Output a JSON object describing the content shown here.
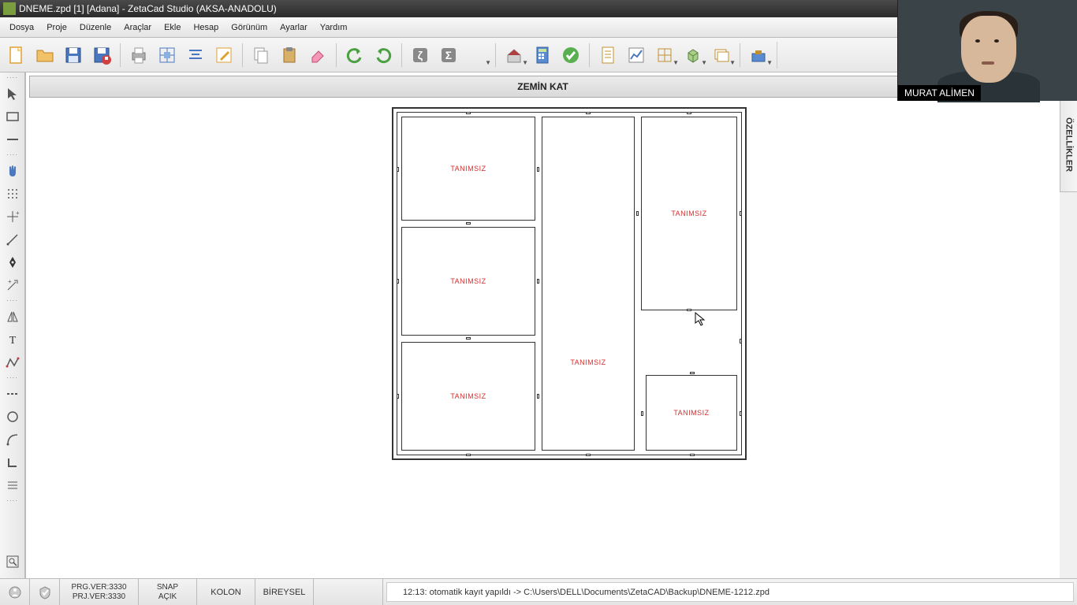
{
  "title": "DNEME.zpd  [1]  [Adana]   - ZetaCad Studio (AKSA-ANADOLU)",
  "menu": [
    "Dosya",
    "Proje",
    "Düzenle",
    "Araçlar",
    "Ekle",
    "Hesap",
    "Görünüm",
    "Ayarlar",
    "Yardım"
  ],
  "canvas_title": "ZEMİN KAT",
  "room_label": "TANIMSIZ",
  "right_panel": "ÖZELLİKLER",
  "webcam_name": "MURAT ALİMEN",
  "status": {
    "prg": "PRG.VER:3330",
    "prj": "PRJ.VER:3330",
    "snap1": "SNAP",
    "snap2": "AÇIK",
    "kolon": "KOLON",
    "bireysel": "BİREYSEL",
    "message": "12:13: otomatik kayıt yapıldı -> C:\\Users\\DELL\\Documents\\ZetaCAD\\Backup\\DNEME-1212.zpd"
  },
  "toolbar_icons": [
    "new-file",
    "open-file",
    "save-file",
    "save-as",
    "sep",
    "print",
    "grid-align",
    "align-center",
    "edit-note",
    "sep",
    "copy",
    "paste",
    "erase",
    "sep",
    "undo",
    "redo",
    "sep",
    "zeta-z",
    "zeta-sigma",
    "dropdown-empty",
    "sep",
    "home-dd",
    "calculator",
    "check-ok",
    "sep",
    "report",
    "chart",
    "structure-dd",
    "cube-dd",
    "window-dd",
    "sep",
    "toolbox-dd"
  ],
  "left_icons": [
    "dots-row",
    "pointer",
    "rect",
    "line",
    "dots-row",
    "hand",
    "grid-dots",
    "crosshair-plus",
    "diagonal",
    "pen-nib",
    "move-arrow",
    "dots-row",
    "mirror",
    "text-T",
    "polyline",
    "dots-row",
    "dashed-line",
    "circle",
    "arc-line",
    "corner",
    "dim-lines",
    "dots-row",
    "spacer",
    "zoom-rect"
  ]
}
